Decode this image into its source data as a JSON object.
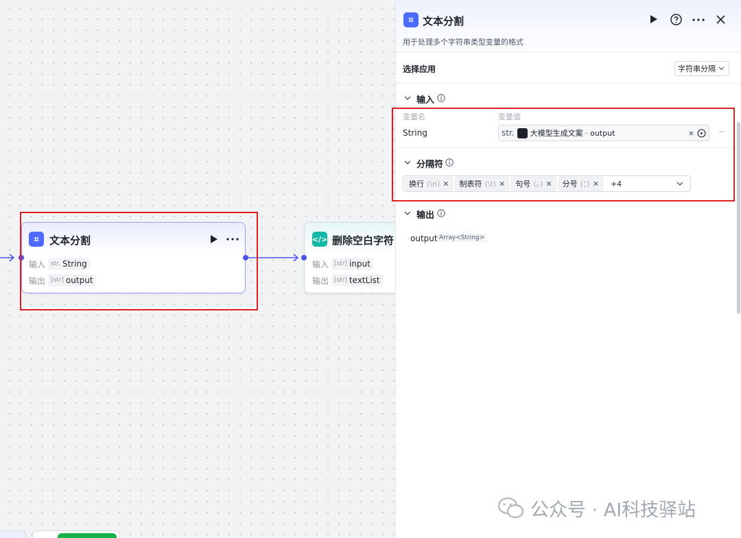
{
  "canvas": {
    "node_text_split": {
      "title": "文本分割",
      "icon": "text-split-icon",
      "input_label": "输入",
      "input_type": "str.",
      "input_value": "String",
      "output_label": "输出",
      "output_type": "[str]",
      "output_value": "output"
    },
    "node_trim": {
      "title": "删除空白字符",
      "icon": "code-icon",
      "input_label": "输入",
      "input_type": "[str]",
      "input_value": "input",
      "output_label": "输出",
      "output_type": "[str]",
      "output_value": "textList"
    }
  },
  "panel": {
    "title": "文本分割",
    "description": "用于处理多个字符串类型变量的格式",
    "select_app_label": "选择应用",
    "select_app_value": "字符串分隔",
    "input_section": {
      "title": "输入",
      "col_name": "变量名",
      "col_value": "变量值",
      "var_name": "String",
      "var_type": "str.",
      "var_ref_text": "大模型生成文案 · output",
      "remove": "−"
    },
    "delimiter_section": {
      "title": "分隔符",
      "chips": [
        {
          "label": "换行",
          "hint": "(\\n)"
        },
        {
          "label": "制表符",
          "hint": "(\\t)"
        },
        {
          "label": "句号",
          "hint": "(。)"
        },
        {
          "label": "分号",
          "hint": "(；)"
        }
      ],
      "more": "+4"
    },
    "output_section": {
      "title": "输出",
      "var_name": "output",
      "var_type": "Array<String>"
    }
  },
  "watermark": "公众号 · AI科技驿站",
  "colors": {
    "accent": "#4d53e8",
    "highlight": "#e02020",
    "code_node": "#14b8a6"
  }
}
